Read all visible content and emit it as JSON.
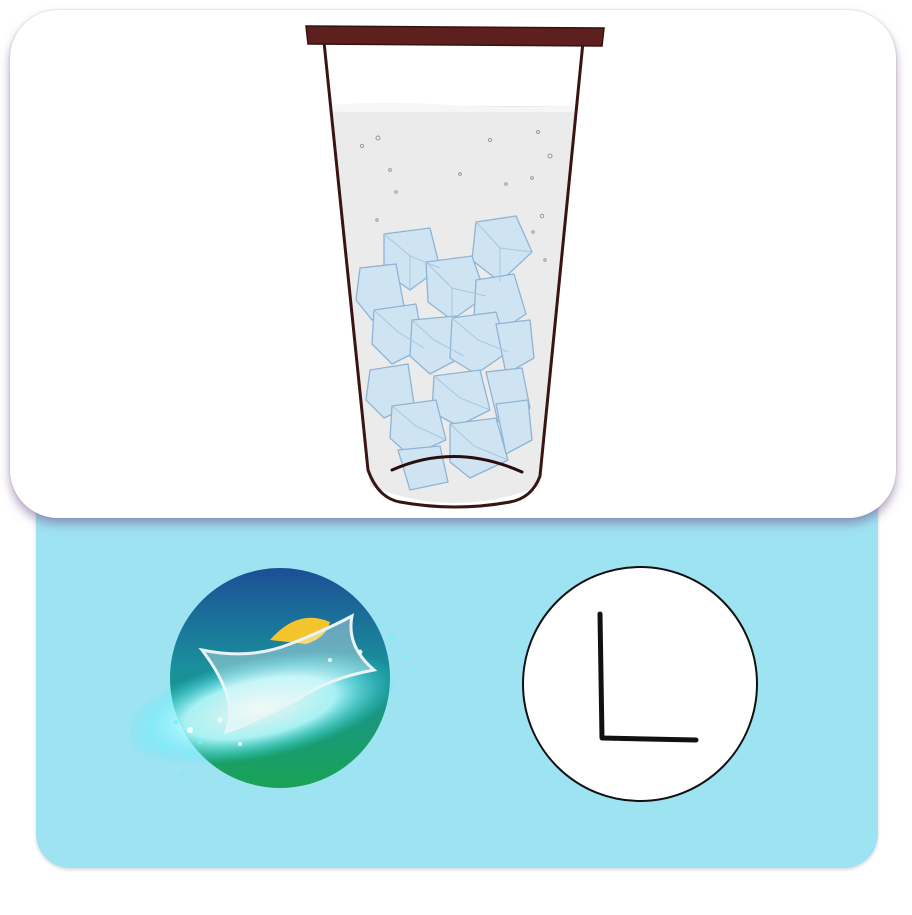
{
  "cup": {
    "icon": "ice-cup-icon",
    "colors": {
      "lid": "#5e1f1f",
      "liquid": "#ececec",
      "ice": "#cfe6f5",
      "outline": "#3a1414"
    }
  },
  "options": {
    "brand": {
      "icon": "sprite-logo-icon",
      "colors": {
        "top": "#1b5a9c",
        "bottom": "#1aa05a",
        "sun": "#f3c42b",
        "splash": "#7ff6ff"
      }
    },
    "size": {
      "label": "L",
      "icon": "size-badge-icon"
    }
  },
  "theme": {
    "panel": "#9ee3f1",
    "card": "#ffffff"
  }
}
